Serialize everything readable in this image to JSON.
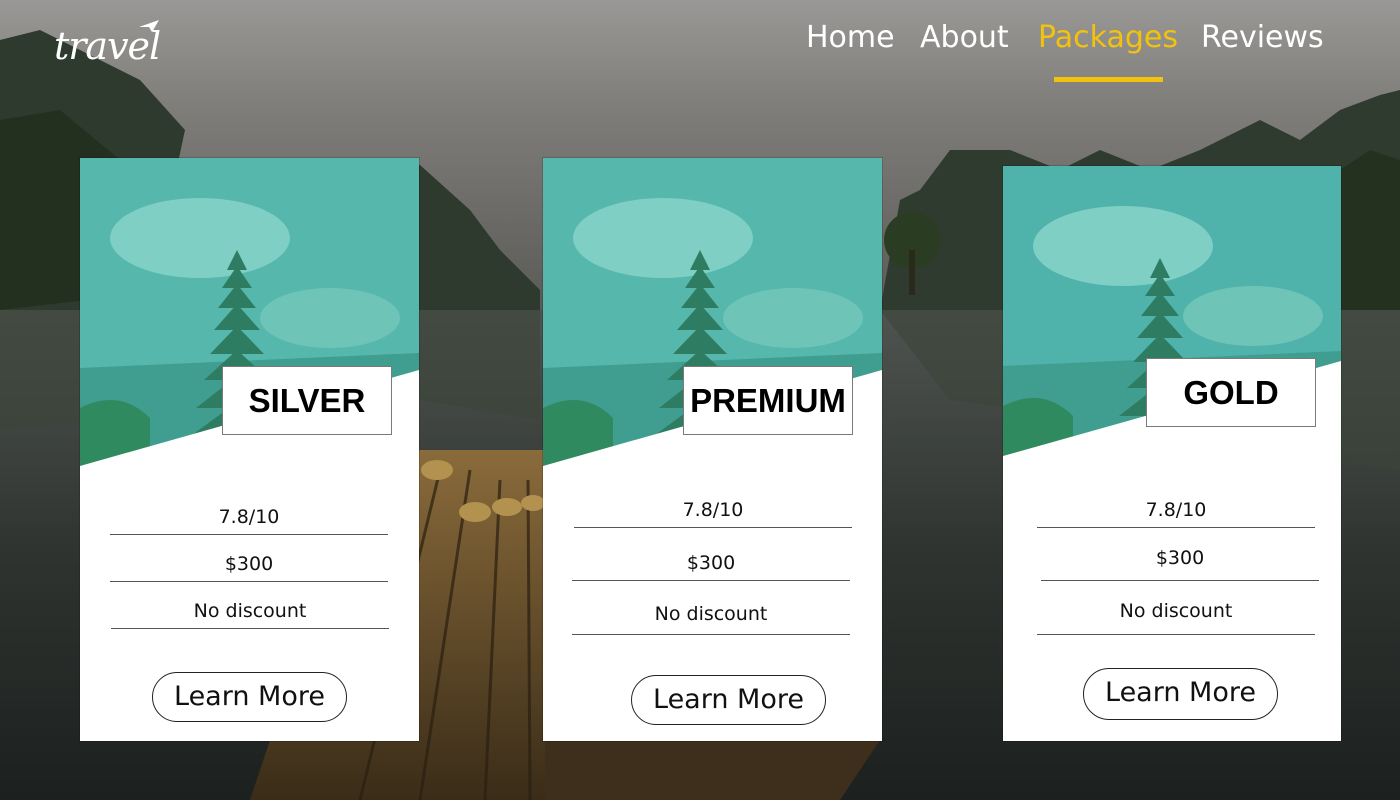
{
  "brand": {
    "logo_text": "travel"
  },
  "nav": {
    "items": [
      {
        "label": "Home",
        "active": false
      },
      {
        "label": "About",
        "active": false
      },
      {
        "label": "Packages",
        "active": true
      },
      {
        "label": "Reviews",
        "active": false
      }
    ],
    "active_color": "#f2c20e"
  },
  "packages": [
    {
      "tier": "SILVER",
      "rating": "7.8/10",
      "price": "$300",
      "discount": "No discount",
      "cta": "Learn More"
    },
    {
      "tier": "PREMIUM",
      "rating": "7.8/10",
      "price": "$300",
      "discount": "No discount",
      "cta": "Learn More"
    },
    {
      "tier": "GOLD",
      "rating": "7.8/10",
      "price": "$300",
      "discount": "No discount",
      "cta": "Learn More"
    }
  ],
  "colors": {
    "card_hero_teal": "#4fb2ab",
    "accent": "#f2c20e"
  }
}
